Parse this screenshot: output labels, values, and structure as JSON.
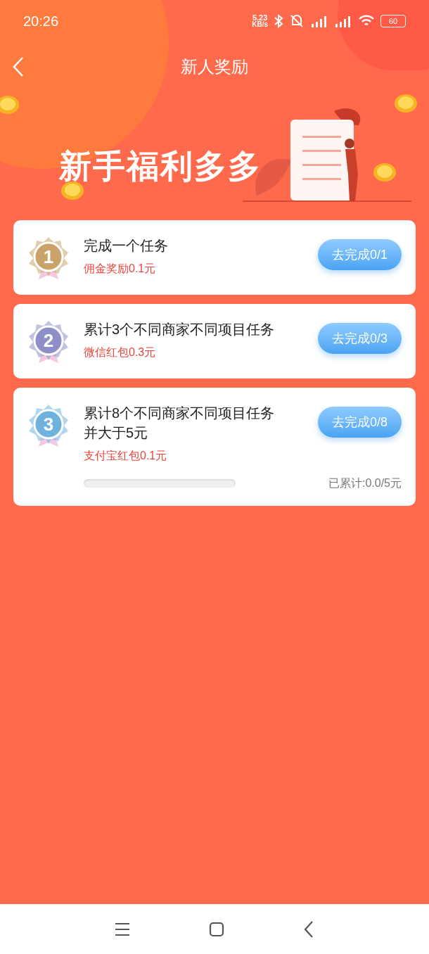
{
  "status_bar": {
    "time": "20:26",
    "speed_value": "5.23",
    "speed_unit": "KB/s",
    "battery": "60"
  },
  "header": {
    "title": "新人奖励"
  },
  "banner": {
    "title": "新手福利多多"
  },
  "tasks": [
    {
      "medal": "1",
      "color": "#c9a36a",
      "title": "完成一个任务",
      "reward": "佣金奖励0.1元",
      "button": "去完成0/1"
    },
    {
      "medal": "2",
      "color": "#8e8fc8",
      "title": "累计3个不同商家不同项目任务",
      "reward": "微信红包0.3元",
      "button": "去完成0/3"
    },
    {
      "medal": "3",
      "color": "#6fb2e0",
      "title": "累计8个不同商家不同项目任务并大于5元",
      "reward": "支付宝红包0.1元",
      "button": "去完成0/8",
      "progress": {
        "level": 0,
        "reading": "已累计:0.0/5元"
      }
    }
  ]
}
